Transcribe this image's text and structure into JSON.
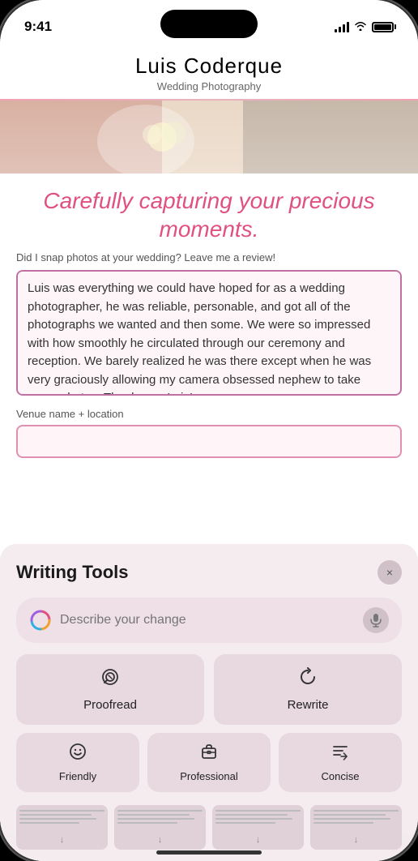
{
  "statusBar": {
    "time": "9:41",
    "batteryLevel": "full"
  },
  "header": {
    "title": "Luis Coderque",
    "subtitle": "Wedding Photography"
  },
  "tagline": {
    "text": "Carefully capturing your precious moments."
  },
  "reviewSection": {
    "prompt": "Did I snap photos at your wedding? Leave me a review!",
    "textareaContent": "Luis was everything we could have hoped for as a wedding photographer, he was reliable, personable, and got all of the photographs we wanted and then some. We were so impressed with how smoothly he circulated through our ceremony and reception. We barely realized he was there except when he was very graciously allowing my camera obsessed nephew to take some photos. Thank you, Luis!",
    "venueLabel": "Venue name + location",
    "venuePlaceholder": ""
  },
  "writingTools": {
    "title": "Writing Tools",
    "closeLabel": "×",
    "describePlaceholder": "Describe your change",
    "proofreadLabel": "Proofread",
    "rewriteLabel": "Rewrite",
    "friendlyLabel": "Friendly",
    "professionalLabel": "Professional",
    "conciseLabel": "Concise"
  }
}
